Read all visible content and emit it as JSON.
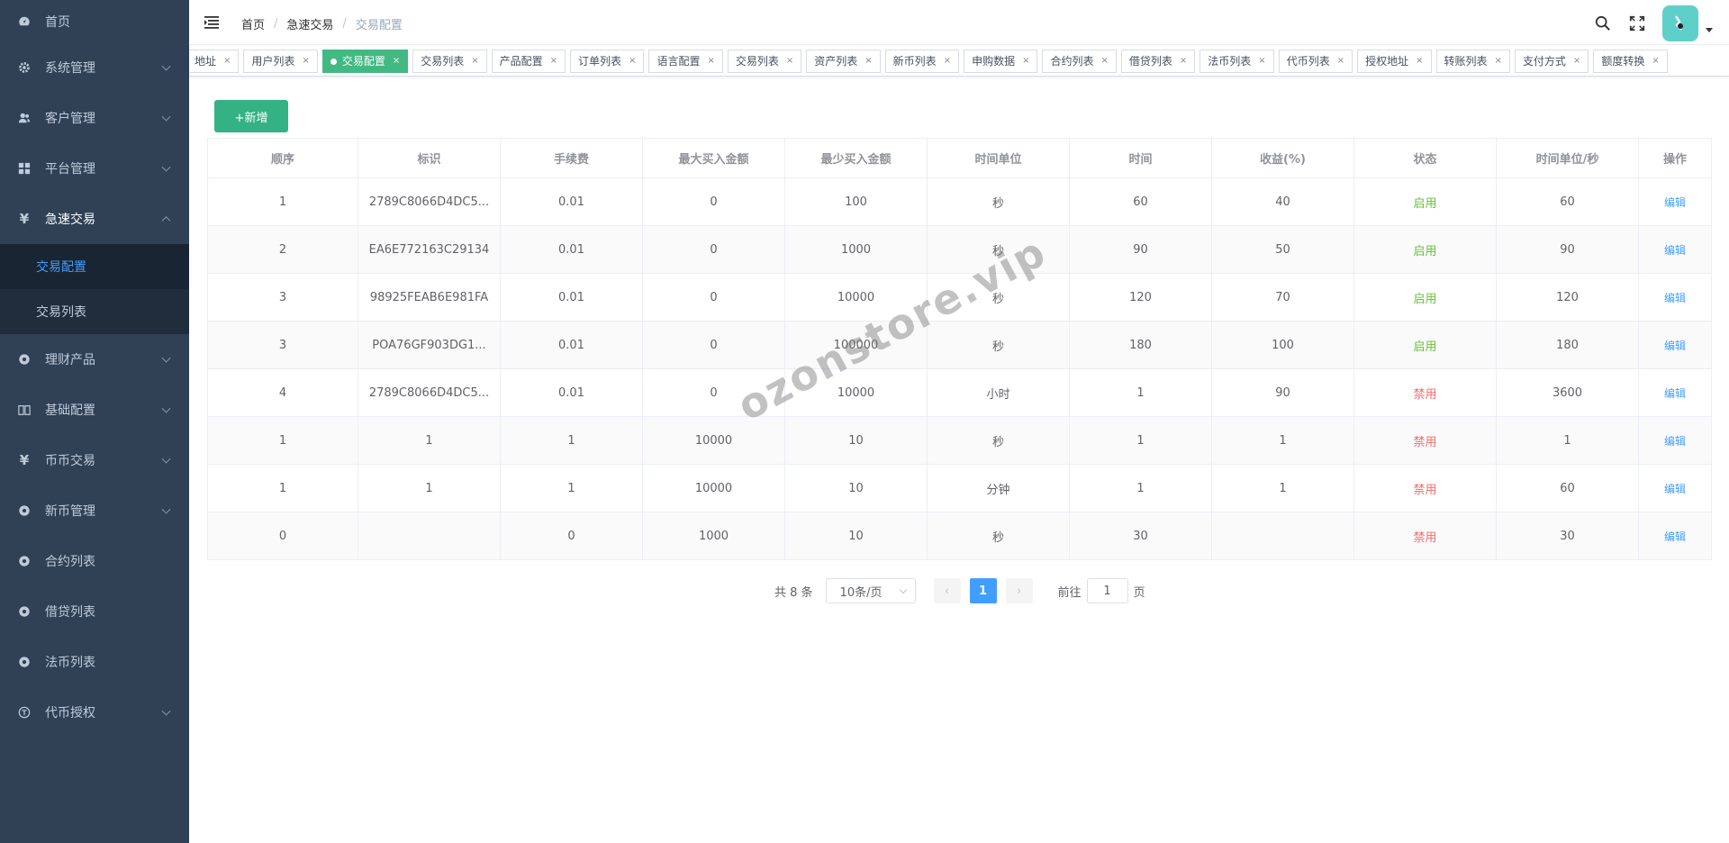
{
  "sidebar": {
    "items": [
      {
        "label": "首页",
        "icon": "dashboard-icon"
      },
      {
        "label": "系统管理",
        "icon": "gear-icon"
      },
      {
        "label": "客户管理",
        "icon": "users-icon"
      },
      {
        "label": "平台管理",
        "icon": "grid-icon"
      },
      {
        "label": "急速交易",
        "icon": "yen-icon"
      },
      {
        "label": "理财产品",
        "icon": "aperture-icon"
      },
      {
        "label": "基础配置",
        "icon": "book-icon"
      },
      {
        "label": "币币交易",
        "icon": "yen-icon"
      },
      {
        "label": "新币管理",
        "icon": "aperture-icon"
      },
      {
        "label": "合约列表",
        "icon": "aperture-icon"
      },
      {
        "label": "借贷列表",
        "icon": "aperture-icon"
      },
      {
        "label": "法币列表",
        "icon": "aperture-icon"
      },
      {
        "label": "代币授权",
        "icon": "token-icon"
      }
    ],
    "submenu": [
      "交易配置",
      "交易列表"
    ]
  },
  "breadcrumb": [
    "首页",
    "急速交易",
    "交易配置"
  ],
  "tags": [
    "地址",
    "用户列表",
    "交易配置",
    "交易列表",
    "产品配置",
    "订单列表",
    "语言配置",
    "交易列表",
    "资产列表",
    "新币列表",
    "申购数据",
    "合约列表",
    "借贷列表",
    "法币列表",
    "代币列表",
    "授权地址",
    "转账列表",
    "支付方式",
    "额度转换"
  ],
  "add_button": "+新增",
  "table": {
    "headers": [
      "顺序",
      "标识",
      "手续费",
      "最大买入金额",
      "最少买入金额",
      "时间单位",
      "时间",
      "收益(%)",
      "状态",
      "时间单位/秒",
      "操作"
    ],
    "rows": [
      [
        "1",
        "2789C8066D4DC5...",
        "0.01",
        "0",
        "100",
        "秒",
        "60",
        "40",
        "启用",
        "60",
        "编辑"
      ],
      [
        "2",
        "EA6E772163C29134",
        "0.01",
        "0",
        "1000",
        "秒",
        "90",
        "50",
        "启用",
        "90",
        "编辑"
      ],
      [
        "3",
        "98925FEAB6E981FA",
        "0.01",
        "0",
        "10000",
        "秒",
        "120",
        "70",
        "启用",
        "120",
        "编辑"
      ],
      [
        "3",
        "POA76GF903DG1...",
        "0.01",
        "0",
        "100000",
        "秒",
        "180",
        "100",
        "启用",
        "180",
        "编辑"
      ],
      [
        "4",
        "2789C8066D4DC5...",
        "0.01",
        "0",
        "10000",
        "小时",
        "1",
        "90",
        "禁用",
        "3600",
        "编辑"
      ],
      [
        "1",
        "1",
        "1",
        "10000",
        "10",
        "秒",
        "1",
        "1",
        "禁用",
        "1",
        "编辑"
      ],
      [
        "1",
        "1",
        "1",
        "10000",
        "10",
        "分钟",
        "1",
        "1",
        "禁用",
        "60",
        "编辑"
      ],
      [
        "0",
        "",
        "0",
        "1000",
        "10",
        "秒",
        "30",
        "",
        "禁用",
        "30",
        "编辑"
      ]
    ]
  },
  "pagination": {
    "total": "共 8 条",
    "page_size": "10条/页",
    "current": "1",
    "goto_label": "前往",
    "goto_value": "1",
    "page_word": "页"
  },
  "watermark": "ozonstore.vip",
  "colors": {
    "sidebar": "#304156",
    "accent": "#409eff",
    "success": "#67c23a",
    "danger": "#f56c6c",
    "add_button": "#34b286",
    "active_tag": "#42b983"
  }
}
